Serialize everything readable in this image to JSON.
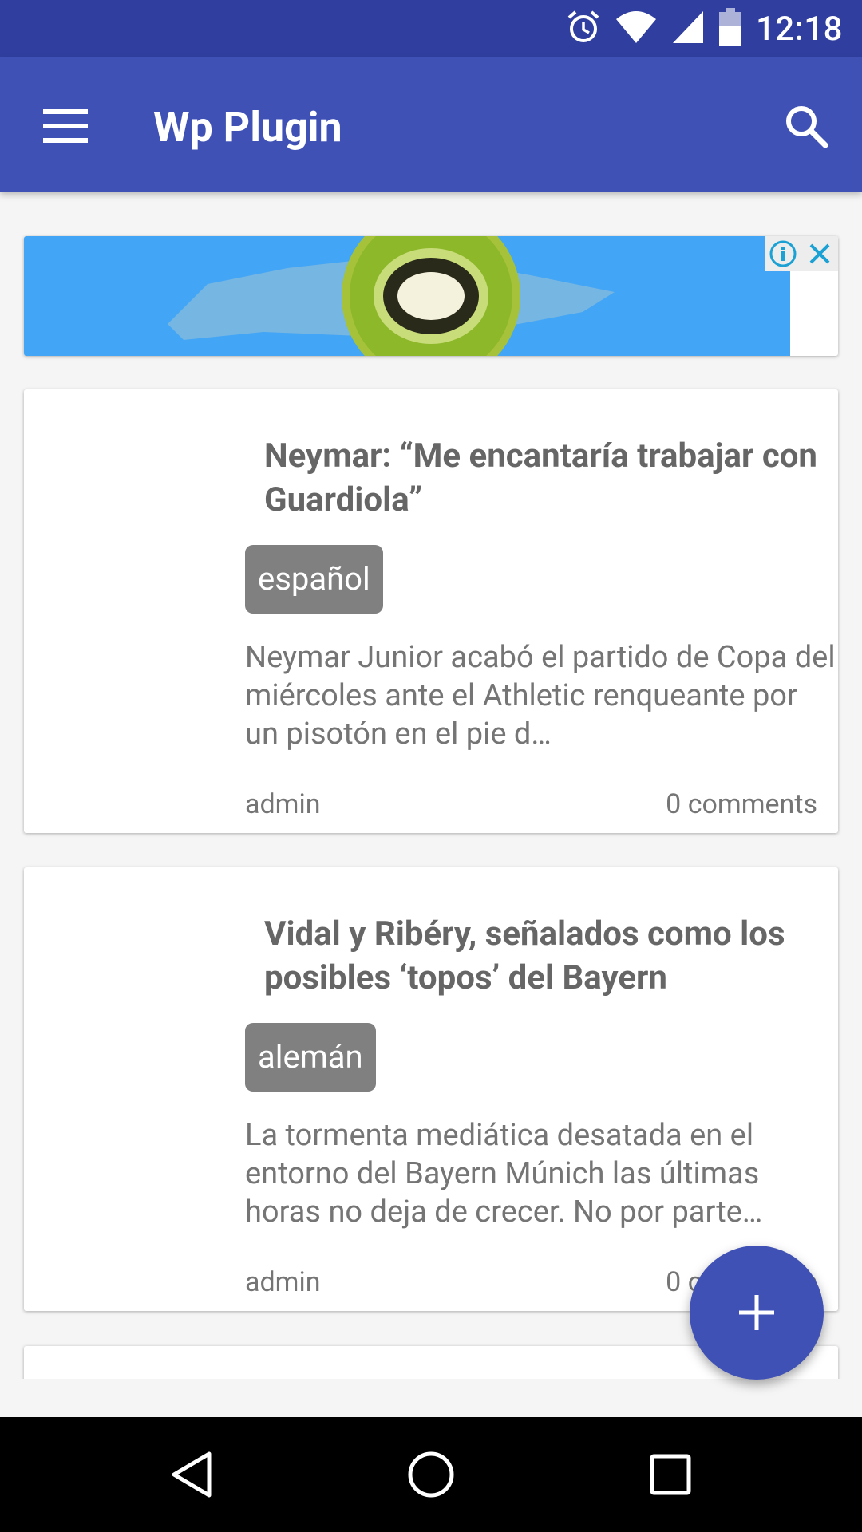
{
  "status_bar": {
    "time": "12:18",
    "icons": [
      "alarm-icon",
      "wifi-icon",
      "signal-icon",
      "battery-icon"
    ],
    "color": "#303F9F"
  },
  "app_bar": {
    "title": "Wp Plugin",
    "menu_icon": "menu-icon",
    "search_icon": "search-icon",
    "color": "#3F51B5"
  },
  "ad": {
    "info_icon": "info-icon",
    "close_icon": "close-icon"
  },
  "posts": [
    {
      "title": "Neymar: “Me encantaría trabajar con Guardiola”",
      "tag": "español",
      "excerpt": "Neymar Junior acabó el partido de Copa del miércoles ante el Athletic renqueante por un pisotón en el pie d…",
      "author": "admin",
      "comments": "0 comments"
    },
    {
      "title": "Vidal y Ribéry, señalados como los posibles ‘topos’ del Bayern",
      "tag": "alemán",
      "excerpt": "La tormenta mediática desatada en el entorno del Bayern Múnich las últimas horas no deja de crecer. No por parte…",
      "author": "admin",
      "comments": "0 comments"
    }
  ],
  "fab": {
    "icon": "plus-icon",
    "color": "#3F51B5"
  },
  "nav_bar": {
    "buttons": [
      "back-icon",
      "home-icon",
      "recents-icon"
    ]
  }
}
